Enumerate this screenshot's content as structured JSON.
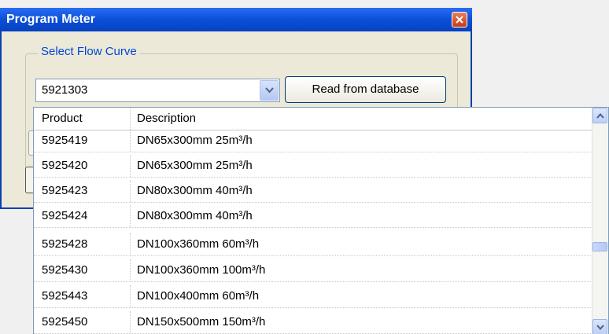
{
  "window": {
    "title": "Program Meter"
  },
  "group": {
    "title": "Select Flow Curve",
    "combo_value": "5921303",
    "read_button": "Read from database"
  },
  "table": {
    "columns": [
      "Product",
      "Description"
    ],
    "rows": [
      {
        "product": "5925419",
        "description": "DN65x300mm 25m³/h"
      },
      {
        "product": "5925420",
        "description": "DN65x300mm 25m³/h"
      },
      {
        "product": "5925423",
        "description": "DN80x300mm 40m³/h"
      },
      {
        "product": "5925424",
        "description": "DN80x300mm 40m³/h"
      },
      {
        "product": "5925428",
        "description": "DN100x360mm 60m³/h"
      },
      {
        "product": "5925430",
        "description": "DN100x360mm 100m³/h"
      },
      {
        "product": "5925443",
        "description": "DN100x400mm 60m³/h"
      },
      {
        "product": "5925450",
        "description": "DN150x500mm 150m³/h"
      }
    ]
  },
  "icons": {
    "close": "close-icon",
    "combo_arrow": "chevron-down-icon",
    "scroll_up": "chevron-up-icon",
    "scroll_down": "chevron-down-icon"
  },
  "colors": {
    "titlebar": "#0a4fd6",
    "group_title": "#0046d5",
    "close": "#c93a11"
  }
}
